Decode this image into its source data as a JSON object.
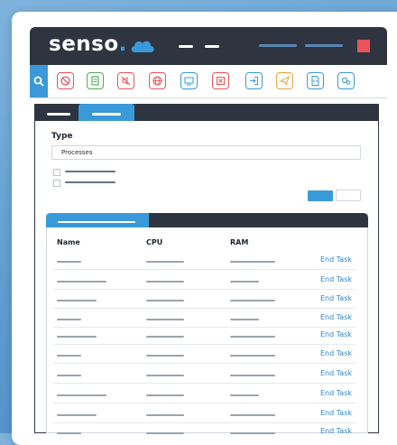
{
  "app": {
    "logo_text": "senso",
    "logo_dot": "."
  },
  "toolbar": {
    "tools": [
      {
        "icon": "block-icon",
        "color": "#e8545a"
      },
      {
        "icon": "checklist-icon",
        "color": "#4caf50"
      },
      {
        "icon": "mute-icon",
        "color": "#e8545a"
      },
      {
        "icon": "globe-icon",
        "color": "#e8545a"
      },
      {
        "icon": "screen-share-icon",
        "color": "#3a9ad9"
      },
      {
        "icon": "close-window-icon",
        "color": "#e8545a"
      },
      {
        "icon": "login-icon",
        "color": "#3a9ad9"
      },
      {
        "icon": "send-icon",
        "color": "#e8a23a"
      },
      {
        "icon": "file-code-icon",
        "color": "#3a9ad9"
      },
      {
        "icon": "settings-icon",
        "color": "#3a9ad9"
      }
    ]
  },
  "form": {
    "type_label": "Type",
    "type_value": "Processes"
  },
  "table": {
    "columns": [
      "Name",
      "CPU",
      "RAM"
    ],
    "action_label": "End Task"
  },
  "colors": {
    "accent": "#3a9ad9",
    "dark": "#2e3540",
    "danger": "#e8545a"
  }
}
